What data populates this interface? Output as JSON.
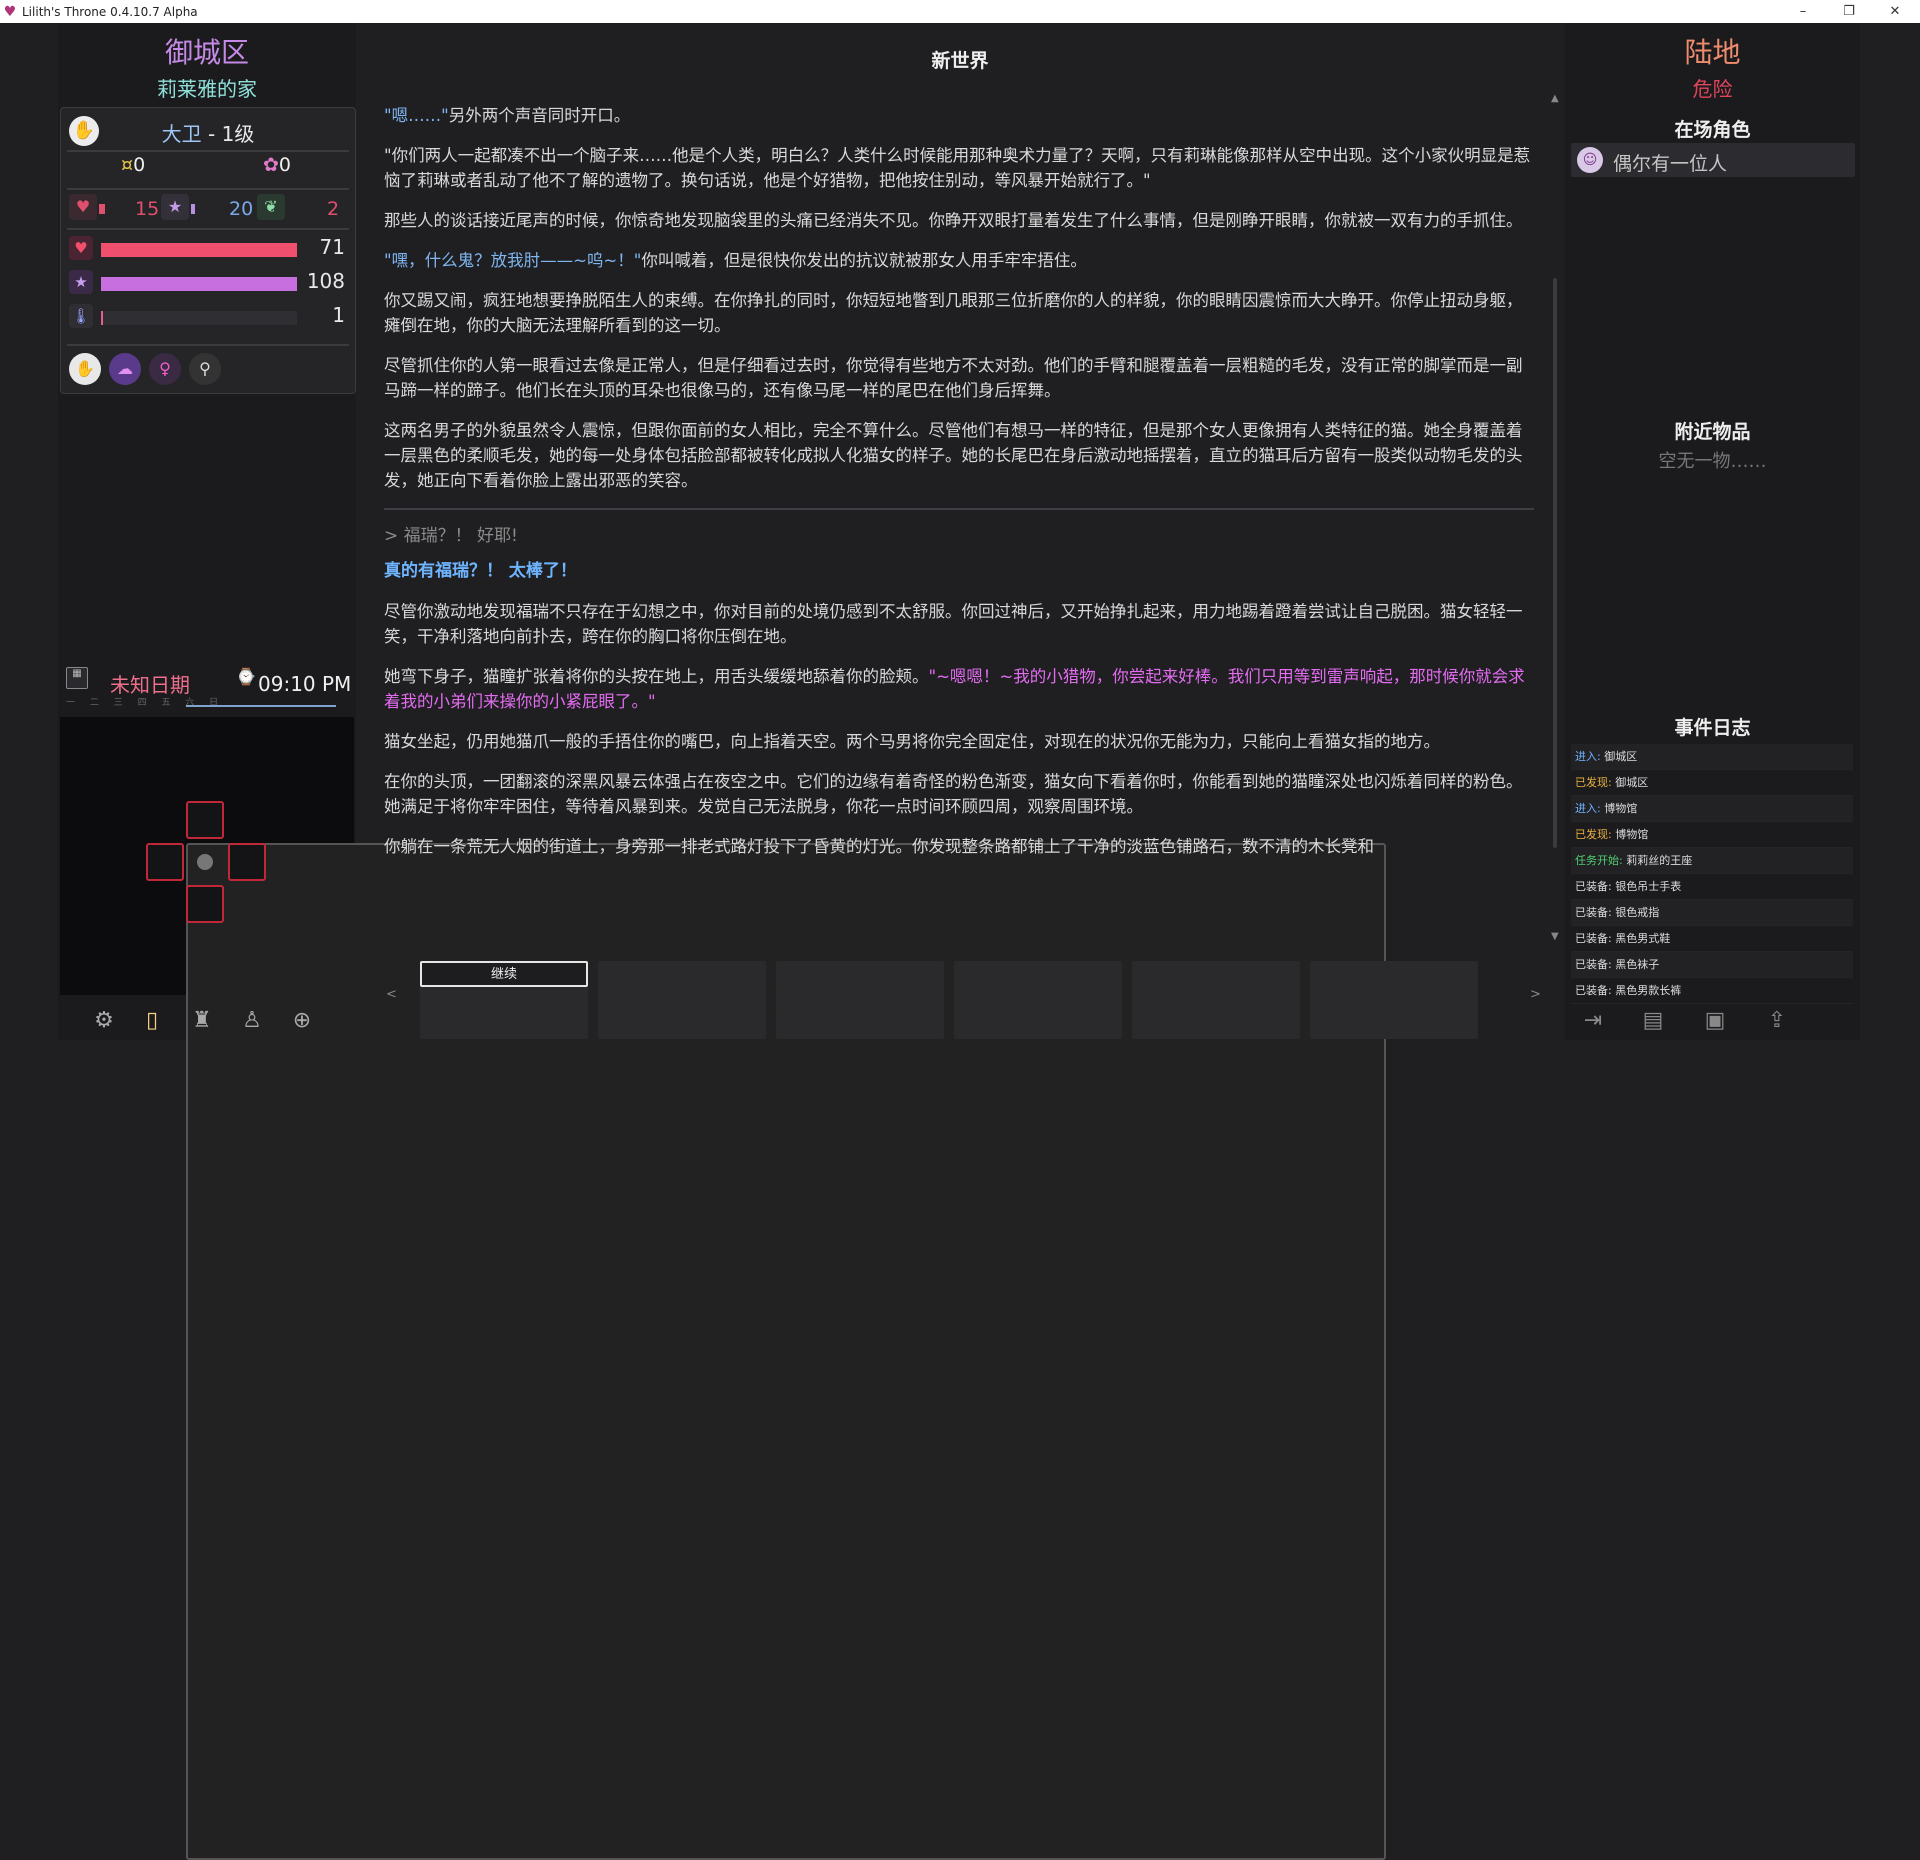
{
  "window": {
    "title": "Lilith's Throne 0.4.10.7 Alpha",
    "minimize": "–",
    "maximize": "❐",
    "close": "✕"
  },
  "left": {
    "location_title": "御城区",
    "location_sub": "莉莱雅的家",
    "character": {
      "name": "大卫",
      "level": " - 1级"
    },
    "currency": {
      "gold_symbol": "¤",
      "gold": "0",
      "essence_symbol": "✿",
      "essence": "0"
    },
    "mini_stats": {
      "arcane": "15",
      "physical": "20",
      "wings": "2"
    },
    "bars": [
      {
        "name": "health",
        "value": "71",
        "fill": 1.0,
        "color": "#f0506e",
        "icon": "heart-icon"
      },
      {
        "name": "aura",
        "value": "108",
        "fill": 1.0,
        "color": "#c86fe0",
        "icon": "star-icon"
      },
      {
        "name": "lust",
        "value": "1",
        "fill": 0.01,
        "color": "#e06090",
        "icon": "thermometer-icon"
      }
    ],
    "date": "未知日期",
    "time": "09:10 PM",
    "weekdays": "一 二 三 四 五 六 日"
  },
  "center": {
    "chapter": "新世界",
    "paragraphs": [
      {
        "speech": "\"嗯……\"",
        "rest": "另外两个声音同时开口。"
      },
      {
        "speech": "\"你们两人一起都凑不出一个脑子来……他是个人类，明白么？人类什么时候能用那种奥术力量了？天啊，只有莉琳能像那样从空中出现。这个小家伙明显是惹恼了莉琳或者乱动了他不了解的遗物了。换句话说，他是个好猎物，把他按住别动，等风暴开始就行了。\""
      },
      {
        "text": "那些人的谈话接近尾声的时候，你惊奇地发现脑袋里的头痛已经消失不见。你睁开双眼打量着发生了什么事情，但是刚睁开眼睛，你就被一双有力的手抓住。"
      },
      {
        "speech": "\"嘿，什么鬼？放我肘——~呜~！\"",
        "rest": "你叫喊着，但是很快你发出的抗议就被那女人用手牢牢捂住。"
      },
      {
        "text": "你又踢又闹，疯狂地想要挣脱陌生人的束缚。在你挣扎的同时，你短短地瞥到几眼那三位折磨你的人的样貌，你的眼睛因震惊而大大睁开。你停止扭动身躯，瘫倒在地，你的大脑无法理解所看到的这一切。"
      },
      {
        "text": "尽管抓住你的人第一眼看过去像是正常人，但是仔细看过去时，你觉得有些地方不太对劲。他们的手臂和腿覆盖着一层粗糙的毛发，没有正常的脚掌而是一副马蹄一样的蹄子。他们长在头顶的耳朵也很像马的，还有像马尾一样的尾巴在他们身后挥舞。"
      },
      {
        "text": "这两名男子的外貌虽然令人震惊，但跟你面前的女人相比，完全不算什么。尽管他们有想马一样的特征，但是那个女人更像拥有人类特征的猫。她全身覆盖着一层黑色的柔顺毛发，她的每一处身体包括脸部都被转化成拟人化猫女的样子。她的长尾巴在身后激动地摇摆着，直立的猫耳后方留有一股类似动物毛发的头发，她正向下看着你脸上露出邪恶的笑容。"
      }
    ],
    "choice_echo": "> 福瑞？！ 好耶!",
    "choice_title": "真的有福瑞？！ 太棒了！",
    "paragraphs2": [
      {
        "text": "尽管你激动地发现福瑞不只存在于幻想之中，你对目前的处境仍感到不太舒服。你回过神后，又开始挣扎起来，用力地踢着蹬着尝试让自己脱困。猫女轻轻一笑，干净利落地向前扑去，跨在你的胸口将你压倒在地。"
      },
      {
        "text": "她弯下身子，猫瞳扩张着将你的头按在地上，用舌头缓缓地舔着你的脸颊。",
        "speech": "\"~嗯嗯！~我的小猎物，你尝起来好棒。我们只用等到雷声响起，那时候你就会求着我的小弟们来操你的小紧屁眼了。\""
      },
      {
        "text": "猫女坐起，仍用她猫爪一般的手捂住你的嘴巴，向上指着天空。两个马男将你完全固定住，对现在的状况你无能为力，只能向上看猫女指的地方。"
      },
      {
        "text": "在你的头顶，一团翻滚的深黑风暴云体强占在夜空之中。它们的边缘有着奇怪的粉色渐变，猫女向下看着你时，你能看到她的猫瞳深处也闪烁着同样的粉色。她满足于将你牢牢困住，等待着风暴到来。发觉自己无法脱身，你花一点时间环顾四周，观察周围环境。"
      },
      {
        "text": "你躺在一条荒无人烟的街道上，身旁那一排老式路灯投下了昏黄的灯光。你发现整条路都铺上了干净的淡蓝色铺路石，数不清的木长凳和"
      }
    ],
    "continue_label": "继续",
    "prev_page": "<",
    "next_page": ">"
  },
  "right": {
    "area_title": "陆地",
    "area_danger": "危险",
    "characters_header": "在场角色",
    "npc_label": "偶尔有一位人",
    "items_header": "附近物品",
    "items_empty": "空无一物……",
    "log_header": "事件日志",
    "log": [
      {
        "tag": "进入:",
        "text": " 御城区",
        "color": "#6fb4ff"
      },
      {
        "tag": "已发现:",
        "text": " 御城区",
        "color": "#e8b040"
      },
      {
        "tag": "进入:",
        "text": " 博物馆",
        "color": "#6fb4ff"
      },
      {
        "tag": "已发现:",
        "text": " 博物馆",
        "color": "#e8b040"
      },
      {
        "tag": "任务开始:",
        "text": " 莉莉丝的王座",
        "color": "#4fd070"
      },
      {
        "tag": "已装备:",
        "text": " 银色吊士手表",
        "color": "#dddddd"
      },
      {
        "tag": "已装备:",
        "text": " 银色戒指",
        "color": "#dddddd"
      },
      {
        "tag": "已装备:",
        "text": " 黑色男式鞋",
        "color": "#dddddd"
      },
      {
        "tag": "已装备:",
        "text": " 黑色袜子",
        "color": "#dddddd"
      },
      {
        "tag": "已装备:",
        "text": " 黑色男款长裤",
        "color": "#dddddd"
      }
    ]
  }
}
